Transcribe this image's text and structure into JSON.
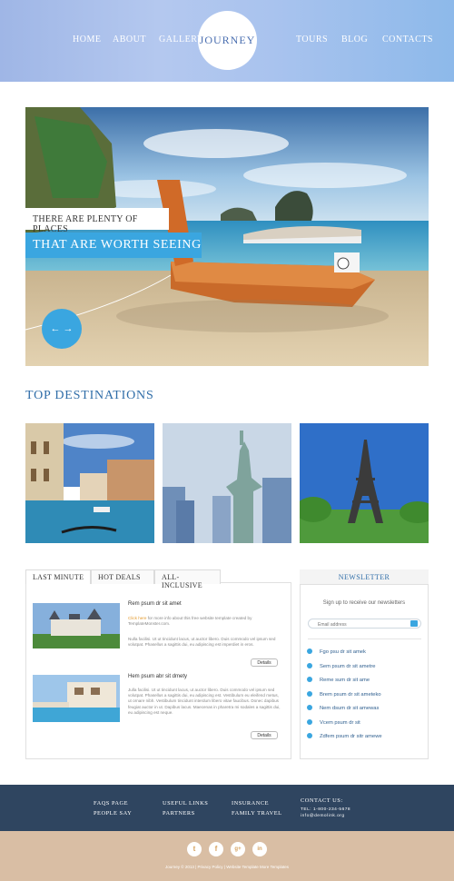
{
  "header": {
    "logo_text": "JOURNEY",
    "nav_left": [
      "HOME",
      "ABOUT",
      "GALLERY"
    ],
    "nav_right": [
      "TOURS",
      "BLOG",
      "CONTACTS"
    ]
  },
  "hero": {
    "caption_small": "THERE ARE PLENTY OF PLACES",
    "caption_large": "THAT ARE WORTH SEEING",
    "arrows": "←  →"
  },
  "destinations": {
    "title": "TOP DESTINATIONS"
  },
  "tabs": {
    "labels": [
      "LAST MINUTE",
      "HOT DEALS",
      "ALL-INCLUSIVE"
    ],
    "posts": [
      {
        "title": "Rem psum dr sit amet",
        "text_accent": "Click here",
        "text_1": " for more info about this free website template created by TemplateMonster.com.",
        "text_2": "Nulla facilisi. Ut ut tincidunt lacus, ut auctor libero. Duis commodo vel ipsum sed volutpat. Phasellus a sagittis dui, eu adipiscing est imperdiet in eros.",
        "button": "Details"
      },
      {
        "title": "Hem psum abr sit dmety",
        "text_2": "Julla facilisi. Ut ut tincidunt lacus, ut auctor libero. Duis commodo vel ipsum sed volutpat. Phasellus a sagittis dui, eu adipiscing est. Vestibulum eu eleifend metus, ut ornare nibh. Vestibulum tincidunt interdum libero vitae faucibus. Donec dapibus feugiat auctor in ut. Dapibus lacus. Maecenas in pharetra mi sodales a sagittis dui, eu adipiscing est neque.",
        "button": "Details"
      }
    ]
  },
  "newsletter": {
    "title": "NEWSLETTER",
    "subtitle": "Sign up to receive our newsletters",
    "placeholder": "Email address",
    "items": [
      "Fgo psu dr sit amek",
      "Sem psum dr sit ametre",
      "Reme sum dr sit ame",
      "Brem psum dr sit ameteko",
      "Nem dsum dr sit amewas",
      "Vcem psum dr sit",
      "Zdfem psum dr sitr amewe"
    ]
  },
  "footer": {
    "col1": [
      "FAQS PAGE",
      "PEOPLE SAY"
    ],
    "col2": [
      "USEFUL LINKS",
      "PARTNERS"
    ],
    "col3": [
      "INSURANCE",
      "FAMILY TRAVEL"
    ],
    "contact_title": "CONTACT US:",
    "contact_phone": "TEL: 1-800-234-5678",
    "contact_email": "info@demolink.org",
    "social_icons": [
      "twitter-icon",
      "facebook-icon",
      "google-plus-icon",
      "linkedin-icon"
    ],
    "social_glyphs": [
      "t",
      "f",
      "g+",
      "in"
    ],
    "copyright": "Journey © 2013 | Privacy Policy | Website Template More Templates"
  },
  "colors": {
    "accent": "#3aa6e0",
    "heading": "#2f6da8",
    "footer_dark": "#2f4560",
    "footer_tan": "#d9bea4"
  }
}
